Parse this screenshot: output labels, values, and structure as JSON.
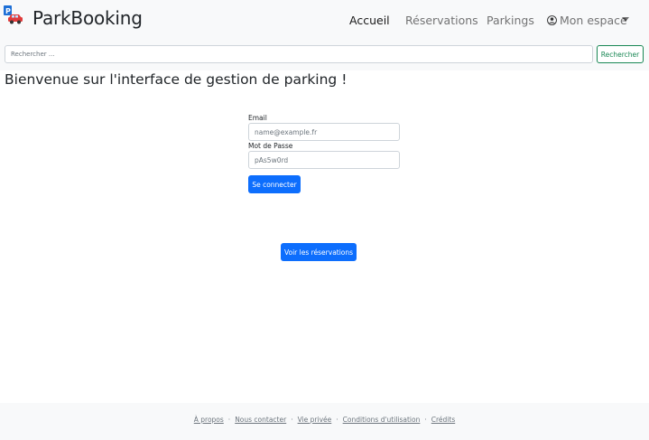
{
  "header": {
    "brand": "ParkBooking",
    "nav": [
      {
        "label": "Accueil",
        "active": true
      },
      {
        "label": "Réservations",
        "active": false
      },
      {
        "label": "Parkings",
        "active": false
      }
    ],
    "account_label": "Mon espace"
  },
  "search": {
    "placeholder": "Rechercher ...",
    "button_label": "Rechercher"
  },
  "main": {
    "title": "Bienvenue sur l'interface de gestion de parking !",
    "login": {
      "email_label": "Email",
      "email_placeholder": "name@example.fr",
      "password_label": "Mot de Passe",
      "password_placeholder": "pAs5w0rd",
      "submit_label": "Se connecter"
    },
    "reservations_button": "Voir les réservations"
  },
  "footer": {
    "links": [
      "À propos",
      "Nous contacter",
      "Vie privée",
      "Conditions d'utilisation",
      "Crédits"
    ],
    "separator": "·"
  },
  "colors": {
    "primary": "#0d6efd",
    "success": "#198754",
    "navbar_bg": "#f8f9fa"
  },
  "icons": {
    "logo": "parking-car-logo-icon",
    "account": "user-circle-icon",
    "dropdown": "caret-down-icon"
  }
}
